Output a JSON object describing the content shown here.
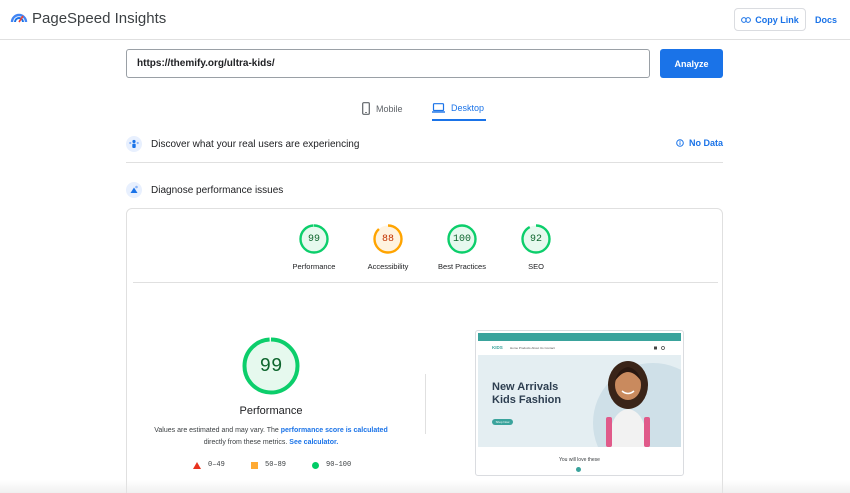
{
  "header": {
    "brand": "PageSpeed Insights",
    "copy_link": "Copy Link",
    "docs": "Docs"
  },
  "search": {
    "url": "https://themify.org/ultra-kids/",
    "analyze": "Analyze"
  },
  "tabs": [
    {
      "label": "Mobile",
      "active": false,
      "icon": "mobile-icon"
    },
    {
      "label": "Desktop",
      "active": true,
      "icon": "desktop-icon"
    }
  ],
  "field_data": {
    "title": "Discover what your real users are experiencing",
    "status": "No Data"
  },
  "diagnose": {
    "title": "Diagnose performance issues"
  },
  "scores": [
    {
      "label": "Performance",
      "value": 99,
      "color": "#0cce6b"
    },
    {
      "label": "Accessibility",
      "value": 88,
      "color": "#ffa400"
    },
    {
      "label": "Best Practices",
      "value": 100,
      "color": "#0cce6b"
    },
    {
      "label": "SEO",
      "value": 92,
      "color": "#0cce6b"
    }
  ],
  "performance": {
    "score": 99,
    "title": "Performance",
    "note_prefix": "Values are estimated and may vary. The",
    "note_link1": "performance score is calculated",
    "note_middle": "directly from these metrics.",
    "note_link2": "See calculator."
  },
  "legend": [
    {
      "range": "0–49",
      "shape": "triangle",
      "color": "#e8321e"
    },
    {
      "range": "50–89",
      "shape": "square",
      "color": "#ffaa33"
    },
    {
      "range": "90–100",
      "shape": "circle",
      "color": "#00cc66"
    }
  ],
  "thumbnail": {
    "logo": "KIDS",
    "menu": "Home   Products   About Us   Contact",
    "hero_line1": "New Arrivals",
    "hero_line2": "Kids Fashion",
    "button": "Shop Now",
    "section": "You will love these"
  }
}
